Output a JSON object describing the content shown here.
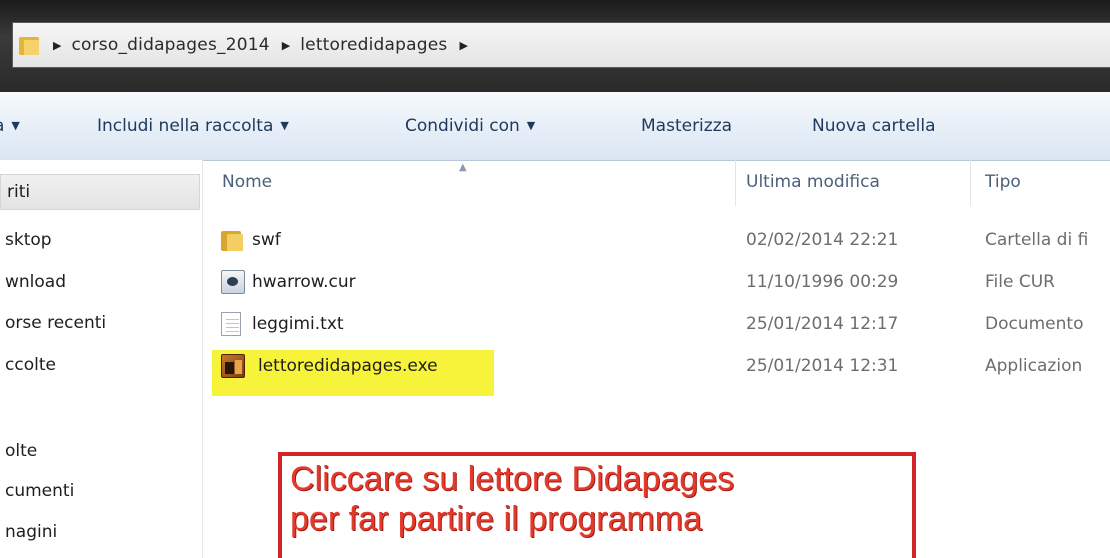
{
  "address_bar": {
    "crumbs": [
      "corso_didapages_2014",
      "lettoredidapages"
    ]
  },
  "toolbar": {
    "truncated_label": "a",
    "items": [
      "Includi nella raccolta",
      "Condividi con",
      "Masterizza",
      "Nuova cartella"
    ]
  },
  "sidebar": {
    "items": [
      "riti",
      "sktop",
      "wnload",
      "orse recenti",
      "ccolte",
      "olte",
      "cumenti",
      "nagini"
    ]
  },
  "columns": {
    "name": "Nome",
    "modified": "Ultima modifica",
    "type": "Tipo"
  },
  "files": [
    {
      "name": "swf",
      "date": "02/02/2014 22:21",
      "type": "Cartella di fi",
      "icon": "folder-icon"
    },
    {
      "name": "hwarrow.cur",
      "date": "11/10/1996 00:29",
      "type": "File CUR",
      "icon": "cursor-file-icon"
    },
    {
      "name": "leggimi.txt",
      "date": "25/01/2014 12:17",
      "type": "Documento",
      "icon": "text-file-icon"
    },
    {
      "name": "lettoredidapages.exe",
      "date": "25/01/2014 12:31",
      "type": "Applicazion",
      "icon": "application-icon"
    }
  ],
  "annotation": {
    "line1": "Cliccare su lettore Didapages",
    "line2": "per far partire il programma"
  },
  "colors": {
    "highlight": "#f7f23a",
    "annotation_red": "#d3242a",
    "toolbar_text": "#1e395b"
  }
}
